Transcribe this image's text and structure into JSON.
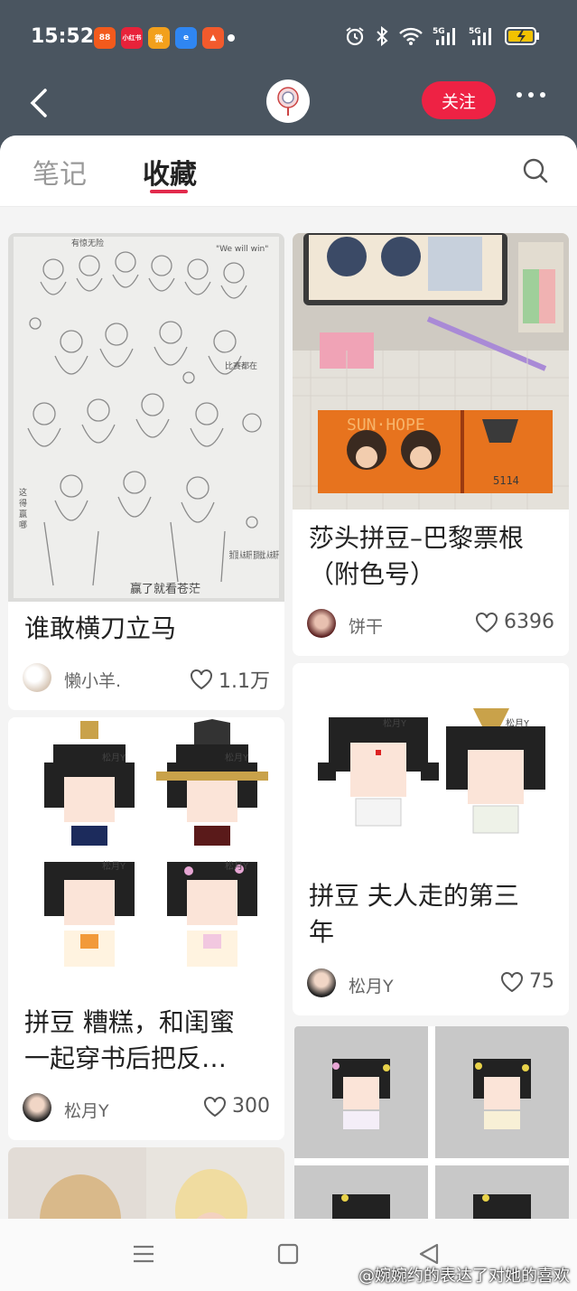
{
  "statusbar": {
    "time": "15:52",
    "apps": [
      {
        "name": "app-icon-1",
        "color": "#f25a1c",
        "label": "88"
      },
      {
        "name": "app-icon-2",
        "color": "#e8223a",
        "label": "小红书"
      },
      {
        "name": "app-icon-3",
        "color": "#f2a01c",
        "label": "微"
      },
      {
        "name": "app-icon-4",
        "color": "#2f86f2",
        "label": "e"
      },
      {
        "name": "app-icon-5",
        "color": "#f25a2c",
        "label": "▲"
      }
    ]
  },
  "nav": {
    "follow_label": "关注"
  },
  "tabs": [
    {
      "label": "笔记",
      "active": false
    },
    {
      "label": "收藏",
      "active": true
    }
  ],
  "cards": [
    {
      "title": "谁敢横刀立马",
      "user": "懒小羊.",
      "likes": "1.1万"
    },
    {
      "title_lines": [
        "莎头拼豆–巴黎票根",
        "（附色号）"
      ],
      "user": "饼干",
      "likes": "6396"
    },
    {
      "title_lines": [
        "拼豆 糟糕，和闺蜜",
        "一起穿书后把反…"
      ],
      "user": "松月Y",
      "likes": "300"
    },
    {
      "title_lines": [
        "拼豆 夫人走的第三",
        "年"
      ],
      "user": "松月Y",
      "likes": "75"
    }
  ],
  "image_text": {
    "ticket": "SUN·HOPE",
    "ticket_num": "5114",
    "sketch_bottom": "赢了就看苍茫",
    "sketch_corner": "我们是 从未离开 直到彼此 从未离开",
    "pixel_wm": "松月Y"
  },
  "watermark": "@婉婉约的表达了对她的喜欢",
  "colors": {
    "accent": "#e22a4c",
    "follow": "#ee2244",
    "header": "#4a5560"
  }
}
